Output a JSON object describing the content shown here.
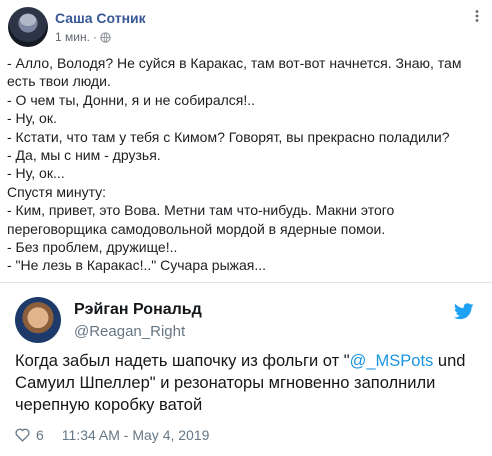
{
  "facebook_post": {
    "author": "Саша Сотник",
    "time": "1 мин.",
    "separator": "·",
    "lines": [
      "- Алло, Володя? Не суйся в Каракас, там вот-вот начнется. Знаю, там",
      "есть твои люди.",
      "- О чем ты, Донни, я и не собирался!..",
      "- Ну, ок.",
      "- Кстати, что там у тебя с Кимом? Говорят, вы прекрасно поладили?",
      "- Да, мы с ним - друзья.",
      "- Ну, ок...",
      "Спустя минуту:",
      "- Ким, привет, это Вова. Метни там что-нибудь. Макни этого",
      "переговорщика самодовольной мордой в ядерные помои.",
      "- Без проблем, дружище!..",
      "- \"Не лезь в Каракас!..\" Сучара рыжая..."
    ]
  },
  "tweet": {
    "name": "Рэйган Рональд",
    "handle": "@Reagan_Right",
    "text_line1_before": "Когда забыл надеть шапочку из фольги от \"",
    "mention": "@_MSPots",
    "text_line1_after": " und",
    "text_line2": "Самуил Шпеллер\" и резонаторы мгновенно заполнили",
    "text_line3": "черепную коробку ватой",
    "likes": "6",
    "timestamp": "11:34 AM - May 4, 2019"
  },
  "colors": {
    "fb_name": "#385898",
    "twitter_blue": "#1da1f2",
    "link": "#1b95e0"
  },
  "icons": [
    "globe-icon",
    "more-options-icon",
    "twitter-bird-icon",
    "heart-icon"
  ]
}
